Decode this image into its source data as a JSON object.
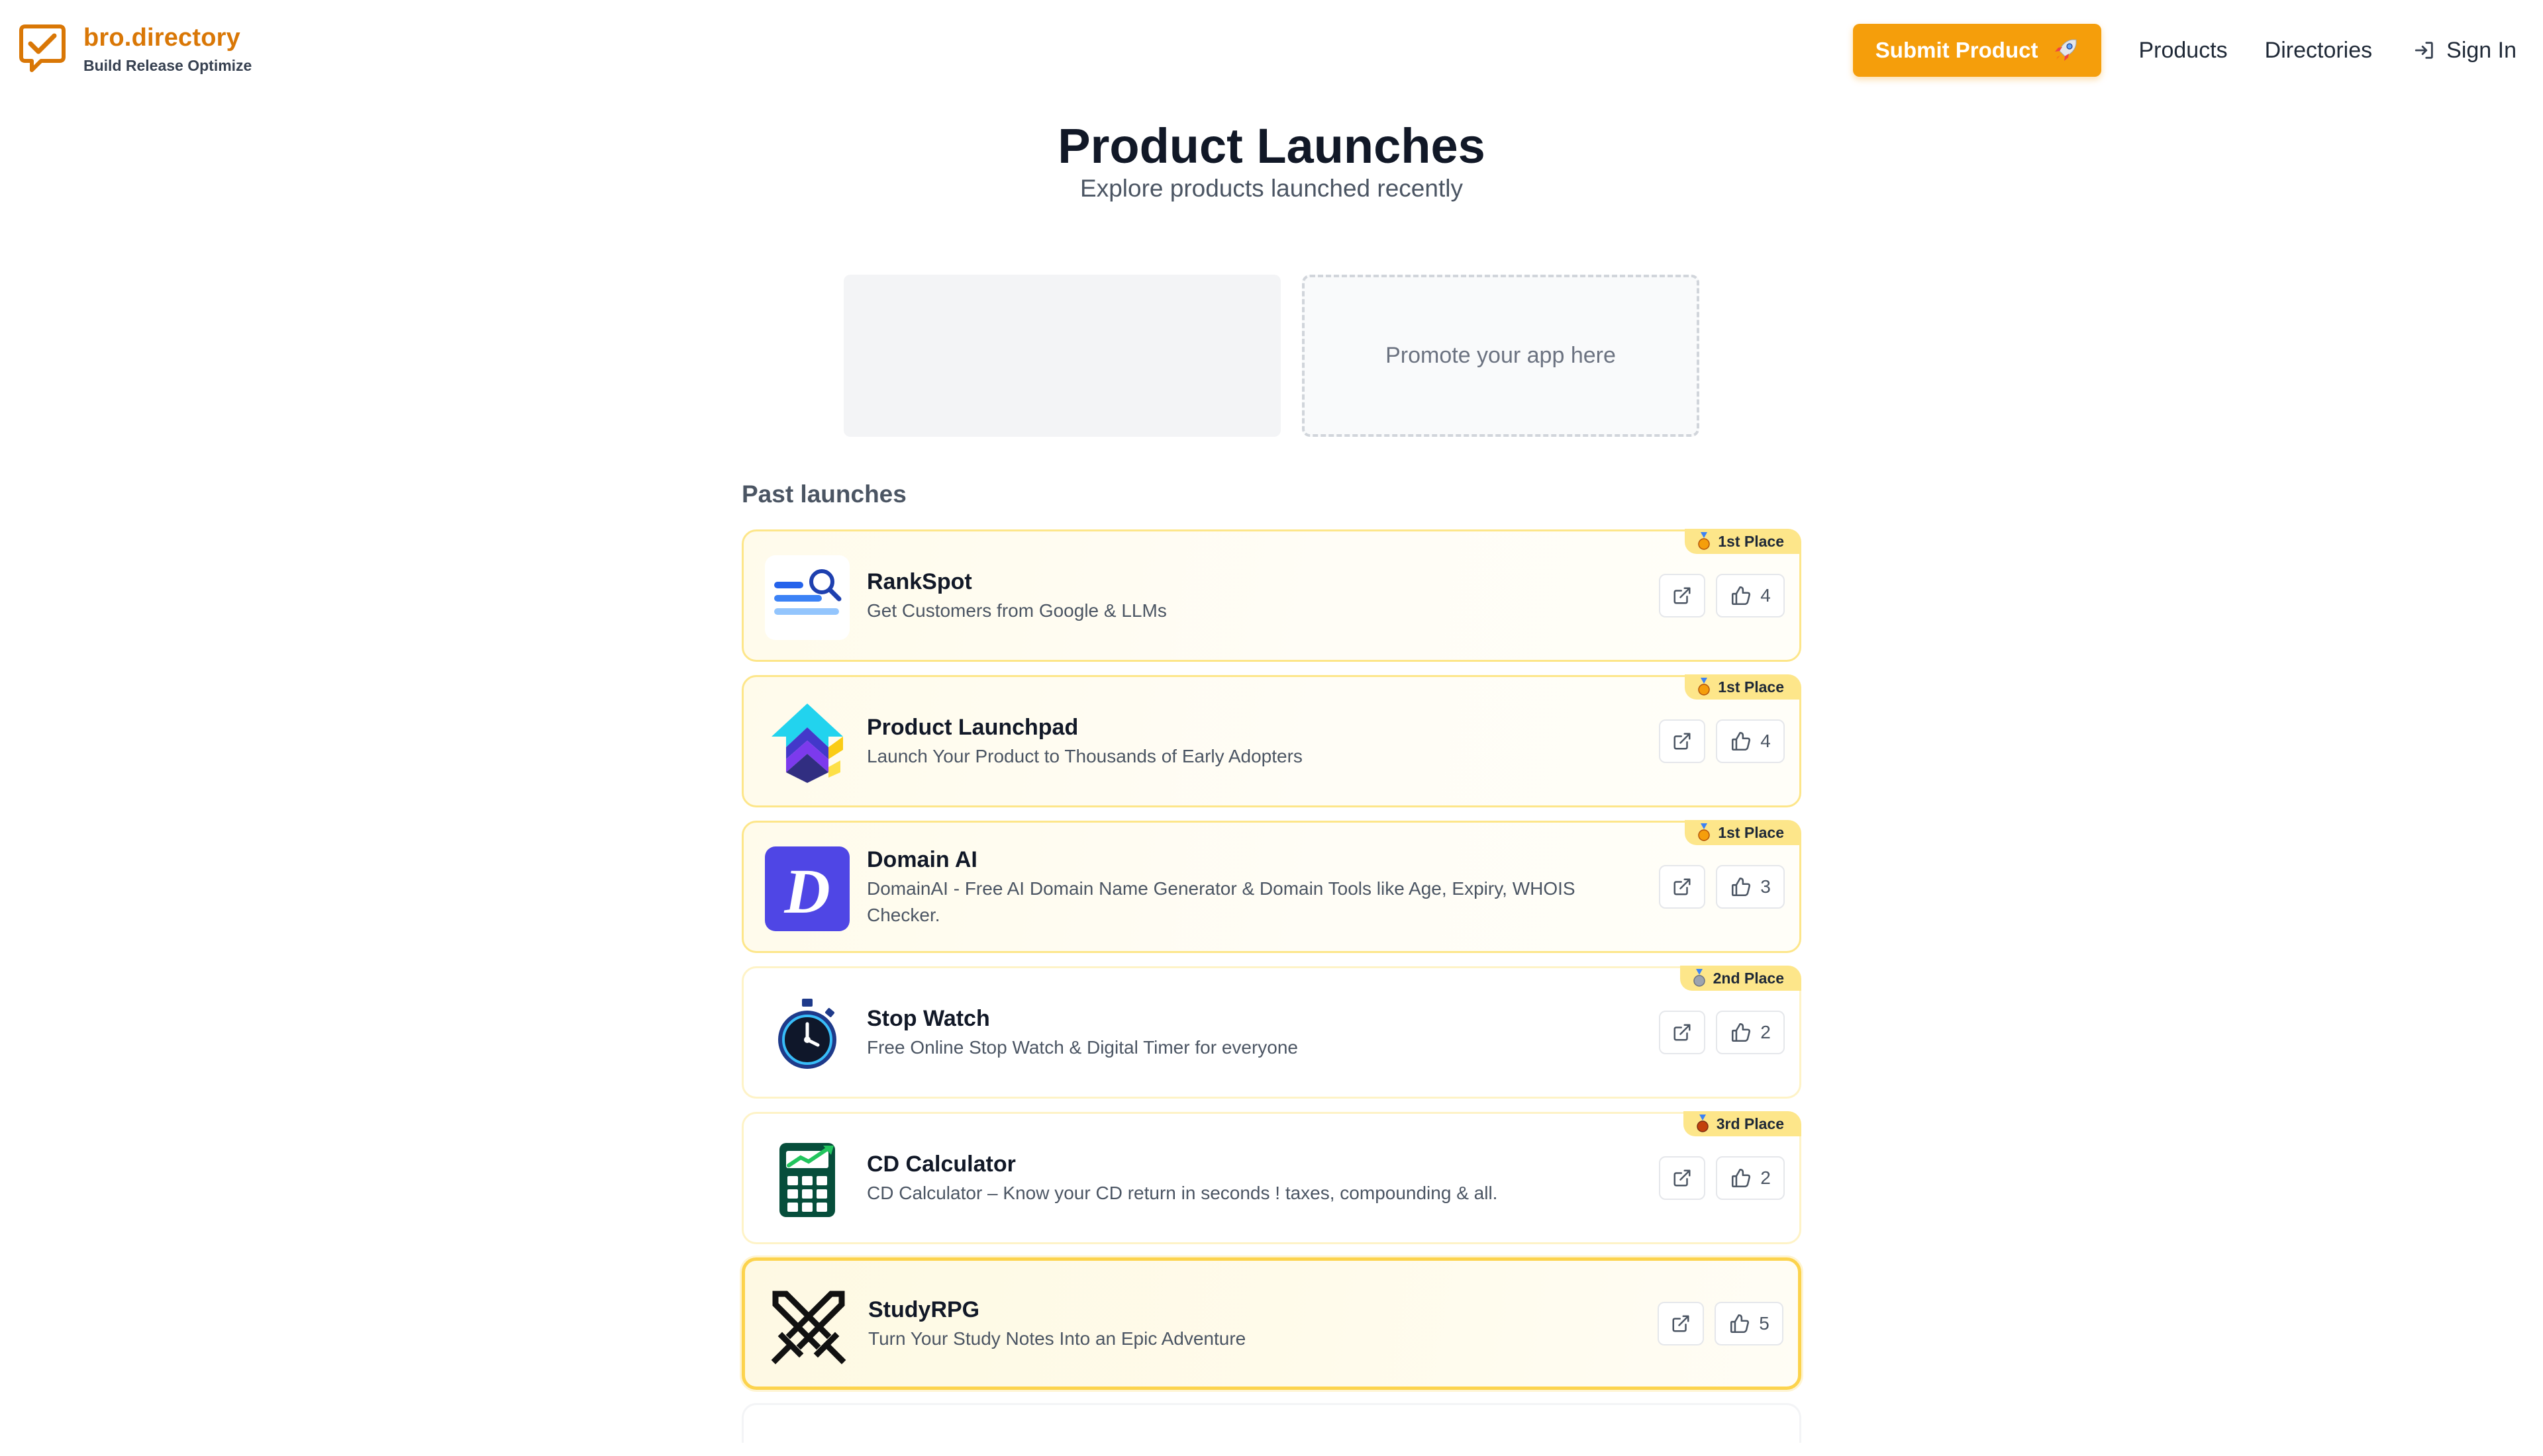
{
  "brand": {
    "name": "bro.directory",
    "tagline": "Build Release Optimize",
    "accent": "#d97706"
  },
  "nav": {
    "submit_label": "Submit Product",
    "submit_icon": "rocket-icon",
    "products_label": "Products",
    "directories_label": "Directories",
    "signin_label": "Sign In",
    "signin_icon": "sign-in-icon"
  },
  "hero": {
    "title": "Product Launches",
    "subtitle": "Explore products launched recently"
  },
  "promo": {
    "cta_text": "Promote your app here"
  },
  "section": {
    "title": "Past launches"
  },
  "launches": [
    {
      "name": "RankSpot",
      "description": "Get Customers from Google & LLMs",
      "badge": "1st Place",
      "medal": "gold-medal-icon",
      "upvotes": "4",
      "logo": "rankspot-logo"
    },
    {
      "name": "Product Launchpad",
      "description": "Launch Your Product to Thousands of Early Adopters",
      "badge": "1st Place",
      "medal": "gold-medal-icon",
      "upvotes": "4",
      "logo": "launchpad-logo"
    },
    {
      "name": "Domain AI",
      "description": "DomainAI - Free AI Domain Name Generator & Domain Tools like Age, Expiry, WHOIS Checker.",
      "badge": "1st Place",
      "medal": "gold-medal-icon",
      "upvotes": "3",
      "logo": "domain-ai-logo"
    },
    {
      "name": "Stop Watch",
      "description": "Free Online Stop Watch & Digital Timer for everyone",
      "badge": "2nd Place",
      "medal": "silver-medal-icon",
      "upvotes": "2",
      "logo": "stopwatch-logo"
    },
    {
      "name": "CD Calculator",
      "description": "CD Calculator – Know your CD return in seconds ! taxes, compounding & all.",
      "badge": "3rd Place",
      "medal": "bronze-medal-icon",
      "upvotes": "2",
      "logo": "calculator-logo"
    },
    {
      "name": "StudyRPG",
      "description": "Turn Your Study Notes Into an Epic Adventure",
      "badge": "",
      "medal": "",
      "upvotes": "5",
      "logo": "crossed-swords-logo"
    }
  ],
  "colors": {
    "submit_bg": "#f59e0b",
    "badge_bg": "#fde68a",
    "card_border": "#fde68a",
    "domain_ai_bg": "#4f46e5"
  }
}
